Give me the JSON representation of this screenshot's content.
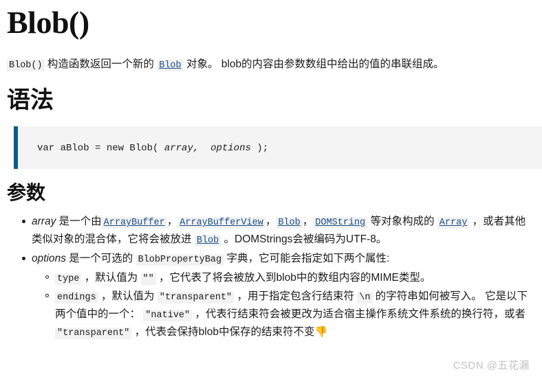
{
  "page": {
    "title": "Blob()",
    "watermark": "CSDN @五花漏"
  },
  "intro": {
    "code_name": "Blob()",
    "text_before_link": " 构造函数返回一个新的 ",
    "link": "Blob",
    "text_after_link": " 对象。 blob的内容由参数数组中给出的值的串联组成。"
  },
  "syntax": {
    "heading": "语法",
    "code": {
      "prefix": "var aBlob = new Blob( ",
      "arg1": "array,",
      "arg2": "options",
      "suffix": " );"
    }
  },
  "parameters": {
    "heading": "参数",
    "items": [
      {
        "name": "array",
        "seg1": " 是一个由",
        "links": [
          "ArrayBuffer",
          "ArrayBufferView",
          "Blob",
          "DOMString"
        ],
        "seg2": " 等对象构成的 ",
        "link_array": "Array",
        "seg3": " ，或者",
        "seg4": "其他类似对象的混合体，它将会被放进 ",
        "link_blob": "Blob",
        "seg5": " 。DOMStrings会被编码为UTF-8。"
      },
      {
        "name": "options",
        "seg1": " 是一个可选的 ",
        "code_dict": "BlobPropertyBag",
        "seg2": " 字典，它可能会指定如下两个属性:",
        "sub_items": [
          {
            "code_name": "type",
            "seg1": " ，默认值为 ",
            "code_value": "\"\"",
            "seg2": " ，它代表了将会被放入到blob中的数组内容的MIME类型。"
          },
          {
            "code_name": "endings",
            "seg1": " ，默认值为 ",
            "code_value": "\"transparent\"",
            "seg2": " ，用于指定包含行结束符 ",
            "code_newline": "\\n",
            "seg3": " 的字符串如何被写入。 它是",
            "seg4": "以下两个值中的一个： ",
            "code_native": "\"native\"",
            "seg5": " ，代表行结束符会被更改为适合宿主操作系统文件系统的换行",
            "seg6": "符，或者 ",
            "code_transparent": "\"transparent\"",
            "seg7": " ，代表会保持blob中保存的结束符不变",
            "emoji": "👎"
          }
        ]
      }
    ]
  }
}
